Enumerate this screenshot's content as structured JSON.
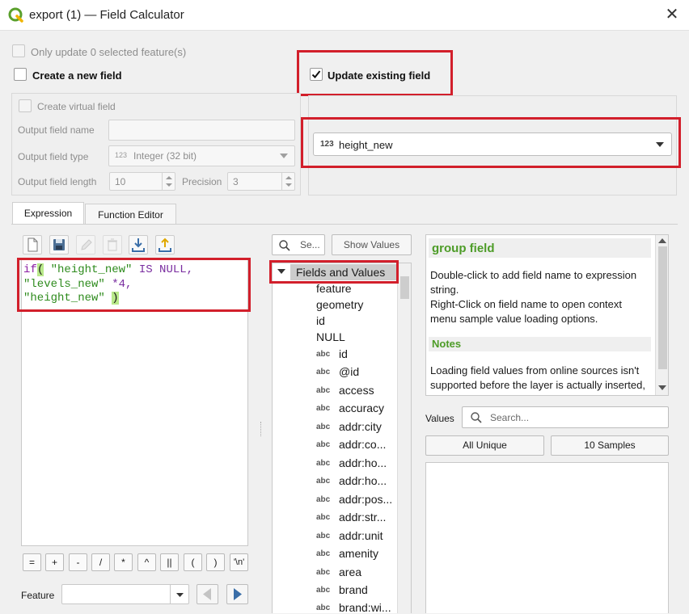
{
  "window": {
    "title": "export (1) — Field Calculator",
    "close_glyph": "✕"
  },
  "options": {
    "only_update_selected": "Only update 0 selected feature(s)",
    "create_new_field": "Create a new field",
    "update_existing_field": "Update existing field",
    "create_virtual_field": "Create virtual field"
  },
  "new_field": {
    "output_field_name_label": "Output field name",
    "output_field_name_value": "",
    "output_field_type_label": "Output field type",
    "output_field_type_prefix": "123",
    "output_field_type_value": "Integer (32 bit)",
    "output_field_length_label": "Output field length",
    "output_field_length_value": "10",
    "precision_label": "Precision",
    "precision_value": "3"
  },
  "existing_field": {
    "type_prefix": "123",
    "value": "height_new"
  },
  "tabs": [
    {
      "label": "Expression"
    },
    {
      "label": "Function Editor"
    }
  ],
  "expression": {
    "line1": {
      "fn": "if",
      "open": "(",
      "field": " \"height_new\"",
      "kw": " IS NULL,",
      "rest": ""
    },
    "line2": {
      "field": "\"levels_new\"",
      "op": " *4,"
    },
    "line3": {
      "field": "\"height_new\"",
      "close": ")"
    }
  },
  "operators": [
    "=",
    "+",
    "-",
    "/",
    "*",
    "^",
    "||",
    "(",
    ")",
    "'\\n'"
  ],
  "feature": {
    "label": "Feature",
    "value": ""
  },
  "search": {
    "placeholder": "Se...",
    "show_values": "Show Values"
  },
  "tree": {
    "root": "Fields and Values",
    "items": [
      {
        "type": "",
        "label": "feature"
      },
      {
        "type": "",
        "label": "geometry"
      },
      {
        "type": "",
        "label": "id"
      },
      {
        "type": "",
        "label": "NULL"
      },
      {
        "type": "abc",
        "label": "id"
      },
      {
        "type": "abc",
        "label": "@id"
      },
      {
        "type": "abc",
        "label": "access"
      },
      {
        "type": "abc",
        "label": "accuracy"
      },
      {
        "type": "abc",
        "label": "addr:city"
      },
      {
        "type": "abc",
        "label": "addr:co..."
      },
      {
        "type": "abc",
        "label": "addr:ho..."
      },
      {
        "type": "abc",
        "label": "addr:ho..."
      },
      {
        "type": "abc",
        "label": "addr:pos..."
      },
      {
        "type": "abc",
        "label": "addr:str..."
      },
      {
        "type": "abc",
        "label": "addr:unit"
      },
      {
        "type": "abc",
        "label": "amenity"
      },
      {
        "type": "abc",
        "label": "area"
      },
      {
        "type": "abc",
        "label": "brand"
      },
      {
        "type": "abc",
        "label": "brand:wi..."
      }
    ]
  },
  "help": {
    "title": "group field",
    "line1": "Double-click to add field name to expression",
    "line2": "string.",
    "line3": "Right-Click on field name to open context",
    "line4": "menu sample value loading options.",
    "notes_title": "Notes",
    "notes1": "Loading field values from online sources isn't",
    "notes2": "supported before the layer is actually inserted,"
  },
  "values": {
    "label": "Values",
    "search_placeholder": "Search...",
    "all_unique": "All Unique",
    "samples": "10 Samples"
  },
  "colors": {
    "highlight_red": "#d21f2b",
    "accent_green": "#4d9c27"
  }
}
